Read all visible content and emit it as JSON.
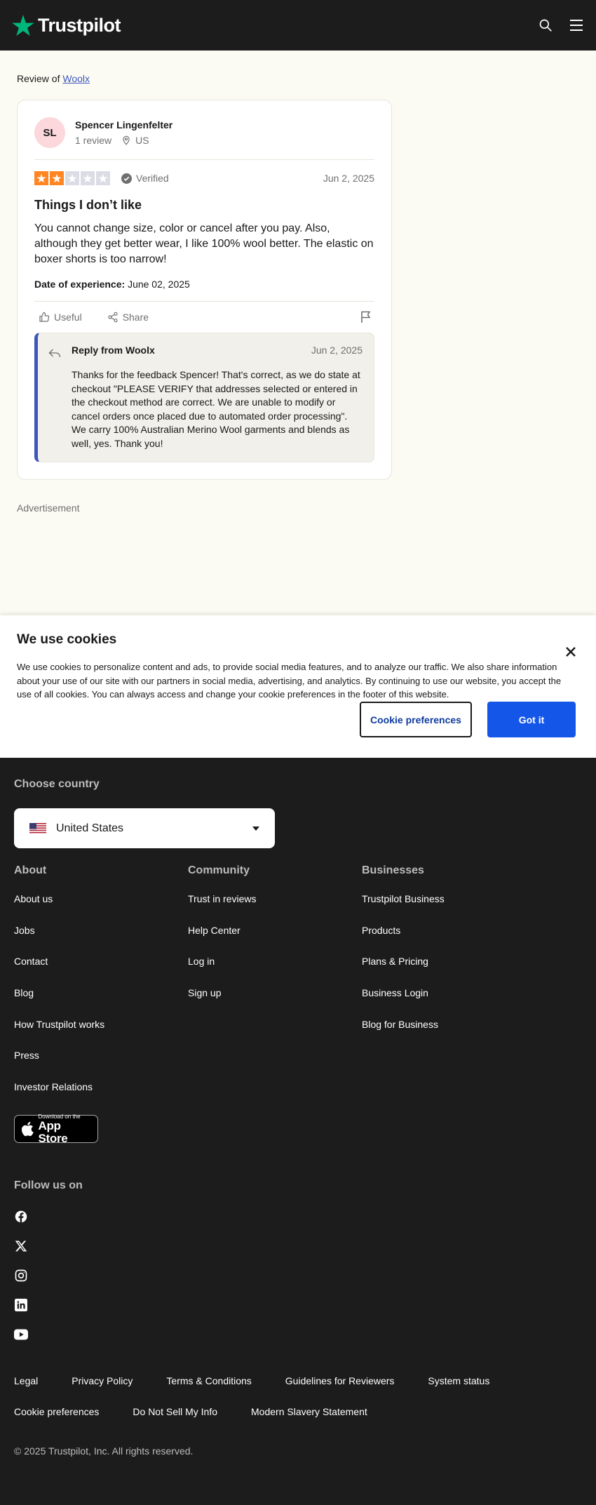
{
  "header": {
    "brand": "Trustpilot",
    "brand_color": "#00b67a"
  },
  "review_of": {
    "prefix": "Review of",
    "company": "Woolx"
  },
  "review": {
    "initials": "SL",
    "user_name": "Spencer Lingenfelter",
    "review_count": "1 review",
    "location": "US",
    "rating": 2,
    "max_rating": 5,
    "star_color": "#ff8622",
    "verified_label": "Verified",
    "date": "Jun 2, 2025",
    "title": "Things I don’t like",
    "body": "You cannot change size, color or cancel after you pay. Also, although they get better wear, I like 100% wool better. The elastic on boxer shorts is too narrow!",
    "experience_label": "Date of experience:",
    "experience_date": "June 02, 2025",
    "useful_label": "Useful",
    "share_label": "Share"
  },
  "reply": {
    "from": "Reply from Woolx",
    "date": "Jun 2, 2025",
    "body": "Thanks for the feedback Spencer! That's correct, as we do state at checkout \"PLEASE VERIFY that addresses selected or entered in the checkout method are correct. We are unable to modify or cancel orders once placed due to automated order processing\". We carry 100% Australian Merino Wool garments and blends as well, yes. Thank you!"
  },
  "advertisement_label": "Advertisement",
  "cookie": {
    "title": "We use cookies",
    "text": "We use cookies to personalize content and ads, to provide social media features, and to analyze our traffic. We also share information about your use of our site with our partners in social media, advertising, and analytics. By continuing to use our website, you accept the use of all cookies. You can always access and change your cookie preferences in the footer of this website.",
    "preferences_label": "Cookie preferences",
    "accept_label": "Got it"
  },
  "footer": {
    "choose_country": "Choose country",
    "country": "United States",
    "about": {
      "heading": "About",
      "links": [
        "About us",
        "Jobs",
        "Contact",
        "Blog",
        "How Trustpilot works",
        "Press",
        "Investor Relations"
      ]
    },
    "community": {
      "heading": "Community",
      "links": [
        "Trust in reviews",
        "Help Center",
        "Log in",
        "Sign up"
      ]
    },
    "businesses": {
      "heading": "Businesses",
      "links": [
        "Trustpilot Business",
        "Products",
        "Plans & Pricing",
        "Business Login",
        "Blog for Business"
      ]
    },
    "app_store": {
      "small": "Download on the",
      "big": "App Store"
    },
    "follow_us": "Follow us on",
    "socials": [
      "facebook-icon",
      "x-icon",
      "instagram-icon",
      "linkedin-icon",
      "youtube-icon"
    ],
    "legal_row1": [
      "Legal",
      "Privacy Policy",
      "Terms & Conditions",
      "Guidelines for Reviewers",
      "System status"
    ],
    "legal_row2": [
      "Cookie preferences",
      "Do Not Sell My Info",
      "Modern Slavery Statement"
    ],
    "copyright": "© 2025 Trustpilot, Inc. All rights reserved."
  }
}
